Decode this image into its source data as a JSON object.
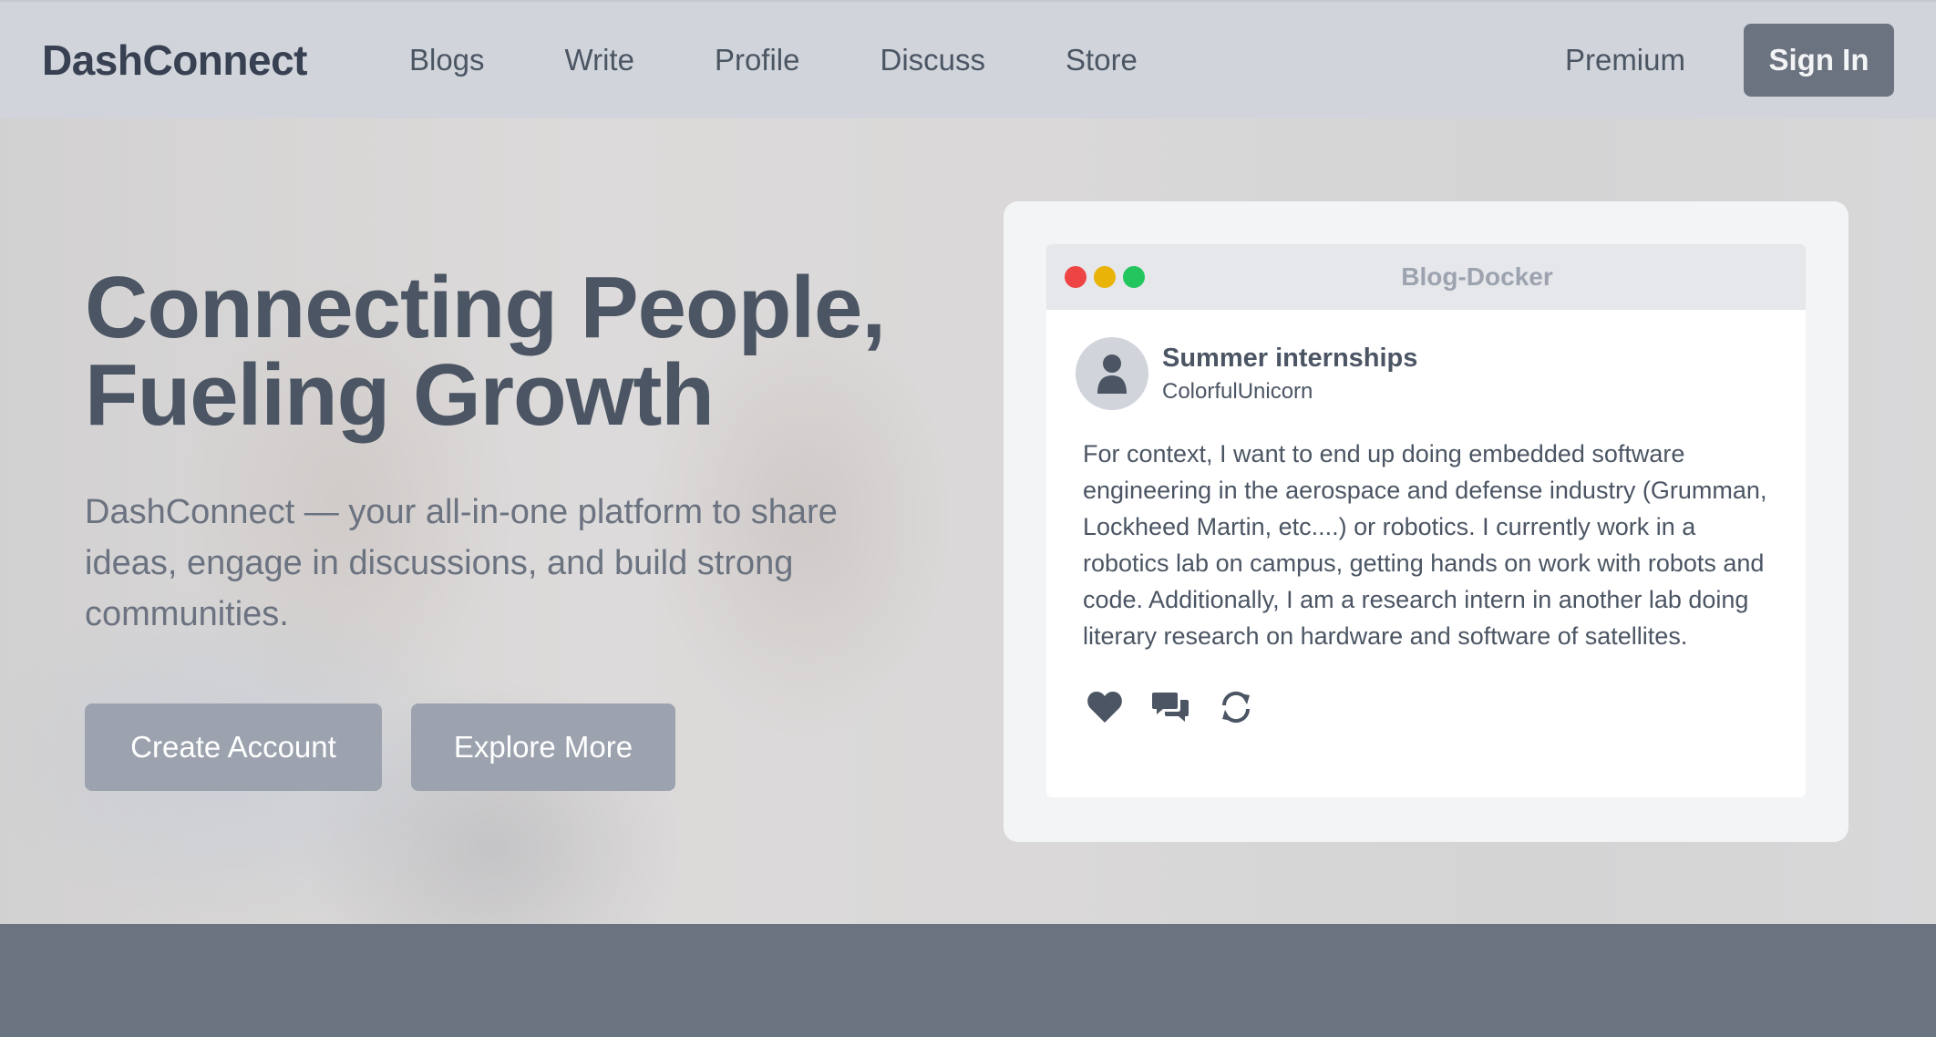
{
  "navbar": {
    "brand": "DashConnect",
    "links": [
      "Blogs",
      "Write",
      "Profile",
      "Discuss",
      "Store"
    ],
    "premium": "Premium",
    "sign_in": "Sign In"
  },
  "hero": {
    "title_line1": "Connecting People,",
    "title_line2": "Fueling Growth",
    "subtitle": "DashConnect — your all-in-one platform to share ideas, engage in discussions, and build strong communities.",
    "create_account": "Create Account",
    "explore_more": "Explore More"
  },
  "card": {
    "window_title": "Blog-Docker",
    "post": {
      "title": "Summer internships",
      "author": "ColorfulUnicorn",
      "body": "For context, I want to end up doing embedded software engineering in the aerospace and defense industry (Grumman, Lockheed Martin, etc....) or robotics. I currently work in a robotics lab on campus, getting hands on work with robots and code. Additionally, I am a research intern in another lab doing literary research on hardware and software of satellites.",
      "actions": [
        "heart-icon",
        "comments-icon",
        "repost-icon"
      ]
    }
  },
  "colors": {
    "navbar_bg": "#d1d5db",
    "sign_in_bg": "#6b7280",
    "hero_button_bg": "#9ca3af",
    "text_primary": "#4b5563",
    "footer_bg": "#6b7280",
    "dot_red": "#ef4444",
    "dot_yellow": "#eab308",
    "dot_green": "#22c55e"
  }
}
